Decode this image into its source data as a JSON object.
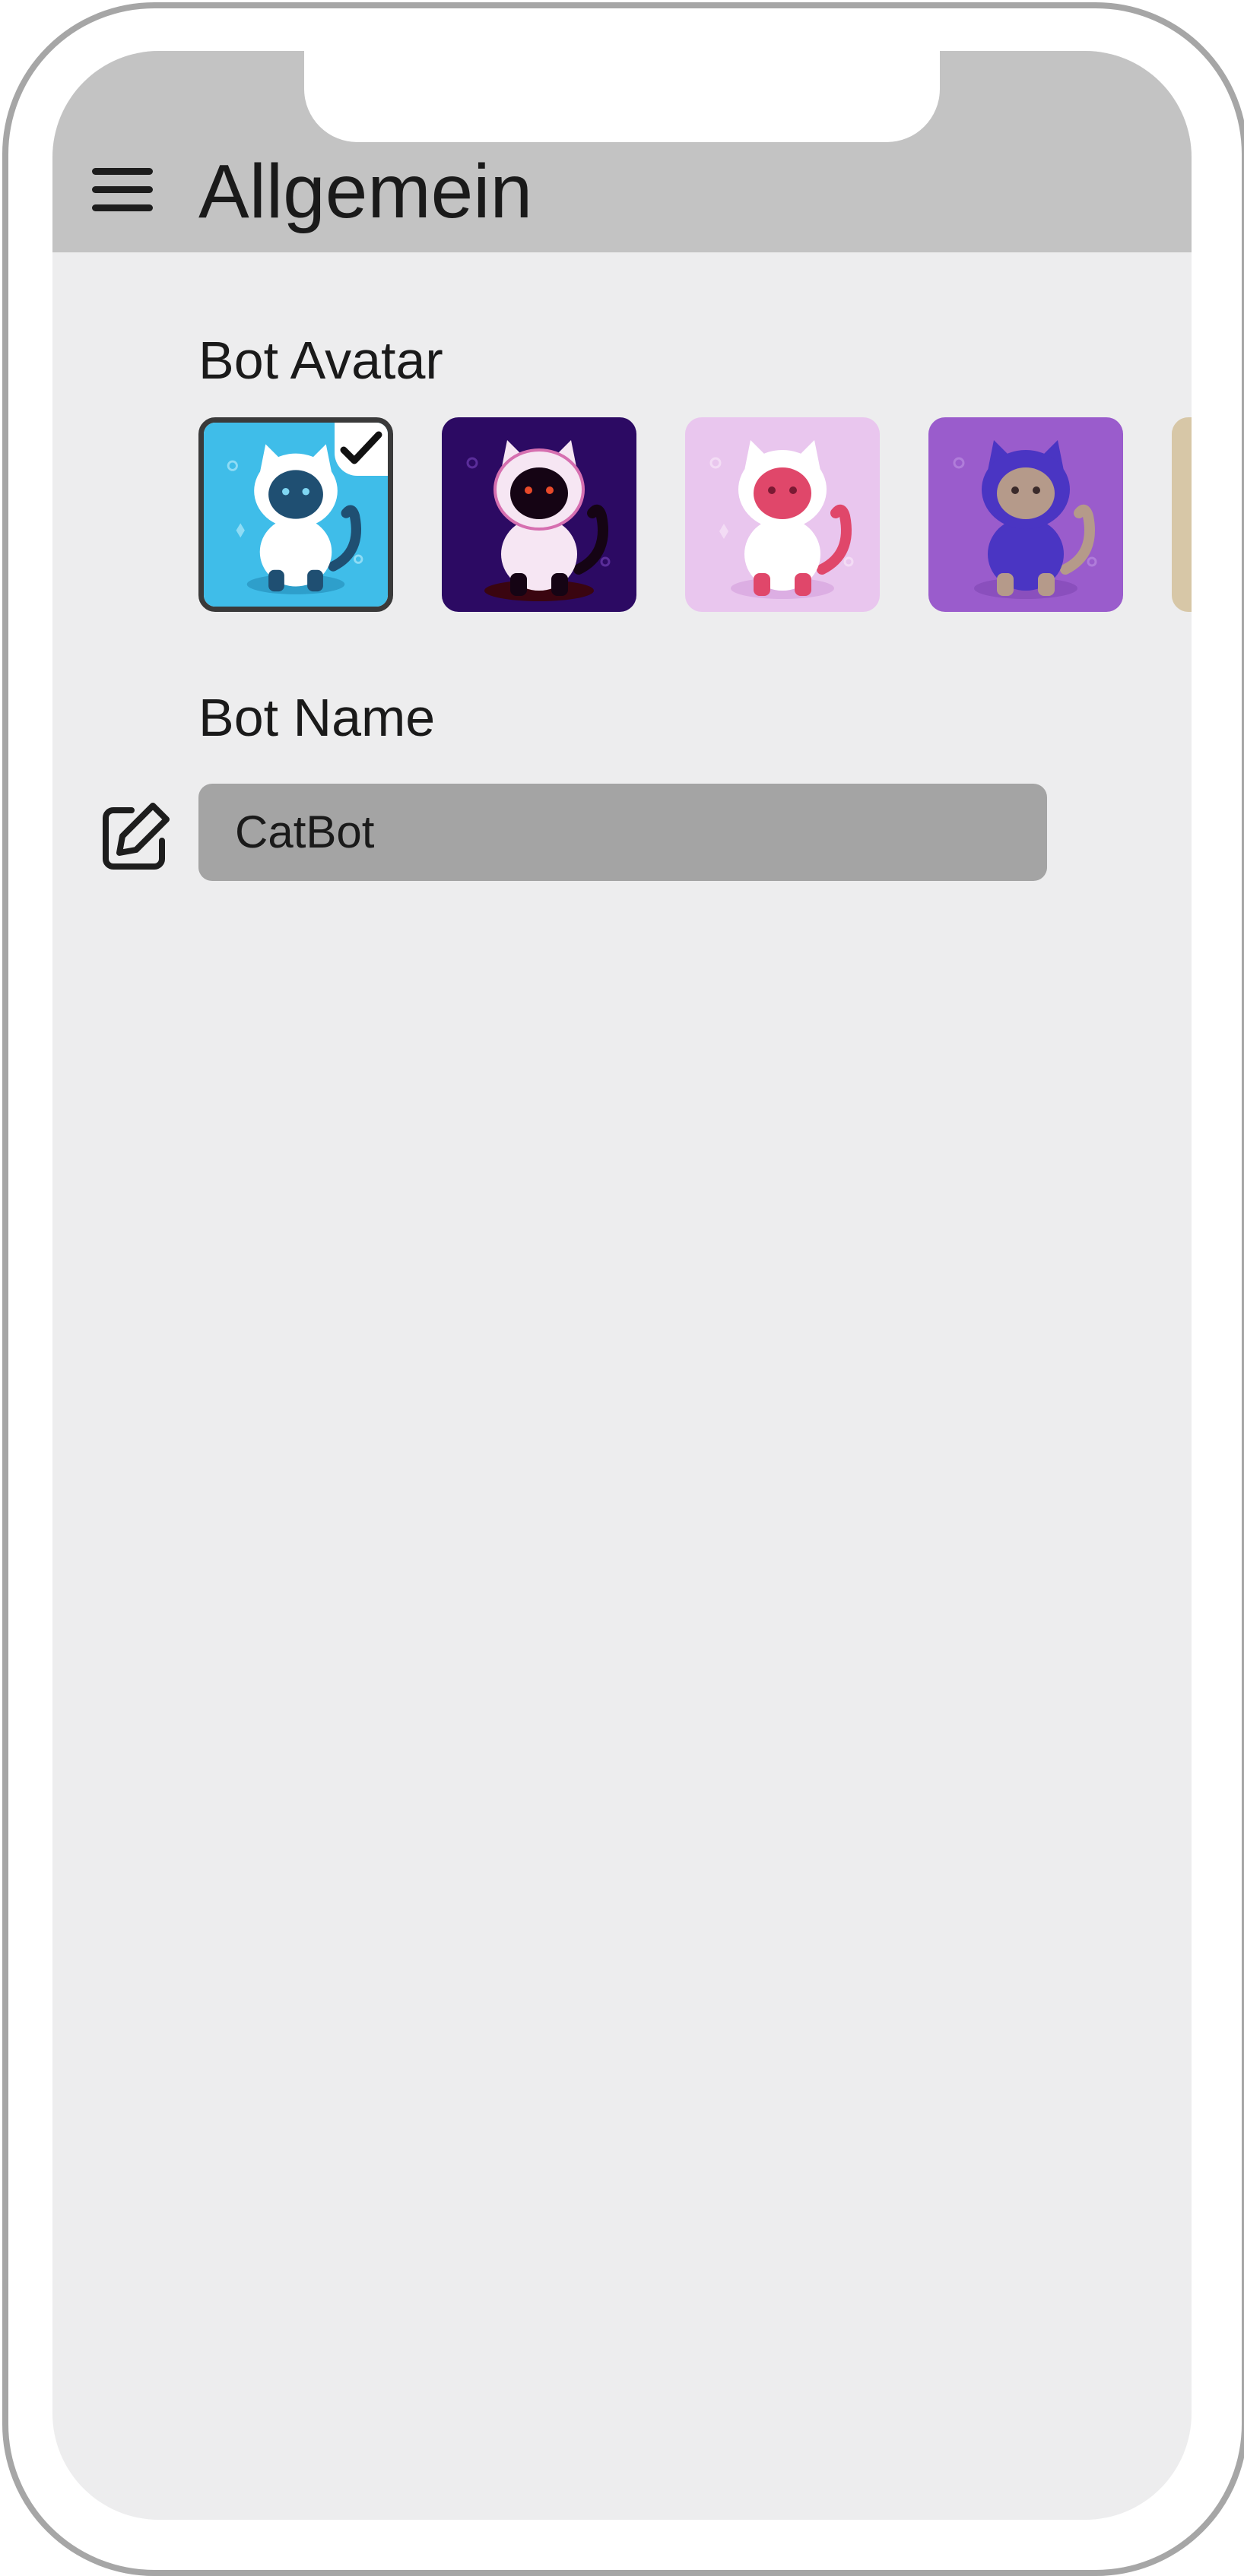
{
  "header": {
    "title": "Allgemein",
    "menu_icon": "hamburger-menu-icon"
  },
  "avatar_section": {
    "label": "Bot Avatar",
    "selected_index": 0,
    "avatars": [
      {
        "id": "avatar-blue-cat",
        "background": "#3fbde9",
        "body": "#ffffff",
        "face": "#1f4f72",
        "accent": "#1f4f72",
        "selected": true
      },
      {
        "id": "avatar-dark-purple-cat",
        "background": "#2c0a63",
        "body": "#f6e6f3",
        "face": "#150414",
        "accent": "#150414",
        "selected": false
      },
      {
        "id": "avatar-pink-cat",
        "background": "#e9c6ee",
        "body": "#ffffff",
        "face": "#e0476a",
        "accent": "#e0476a",
        "selected": false
      },
      {
        "id": "avatar-violet-cat",
        "background": "#9a5ccc",
        "body": "#4a35c3",
        "face": "#b59a8a",
        "accent": "#b59a8a",
        "selected": false
      },
      {
        "id": "avatar-beige-cat",
        "background": "#e6dccb",
        "body": "#d9c9ad",
        "face": "#c7b28f",
        "accent": "#c7b28f",
        "selected": false
      }
    ],
    "check_icon": "checkmark-icon"
  },
  "name_section": {
    "label": "Bot Name",
    "value": "CatBot",
    "edit_icon": "edit-pencil-icon"
  },
  "colors": {
    "header_bg": "#c3c3c3",
    "screen_bg": "#ededee",
    "input_bg": "#a4a4a4",
    "text": "#1a1a1a"
  }
}
